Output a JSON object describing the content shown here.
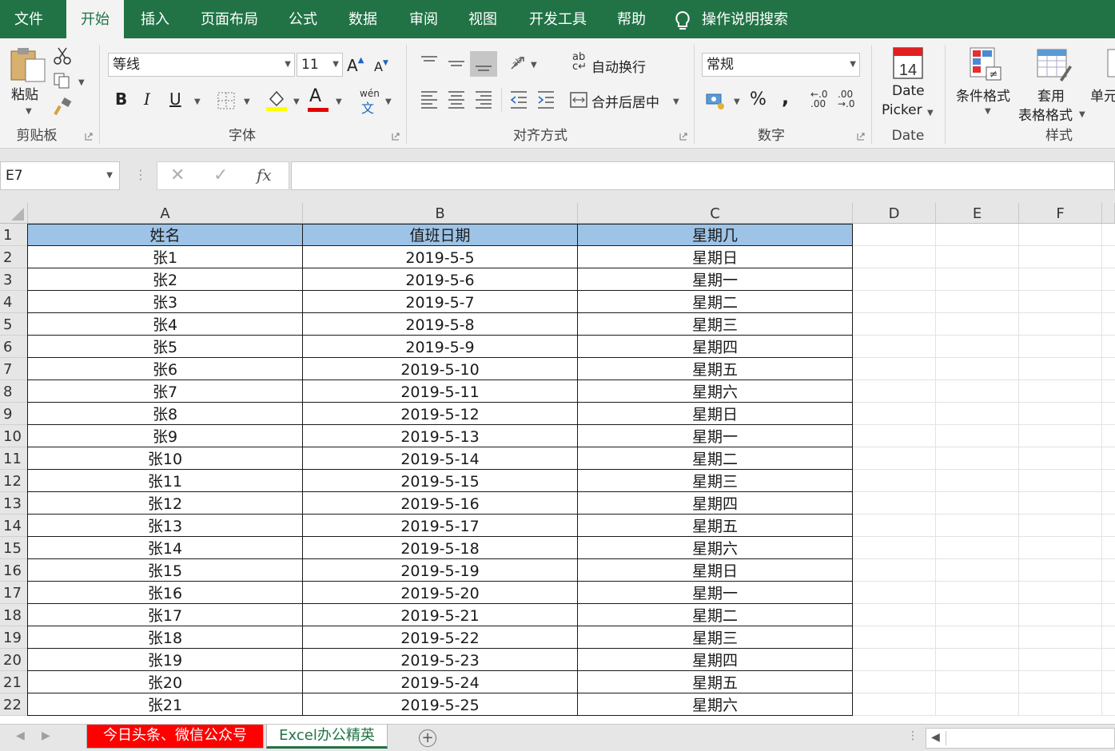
{
  "tabs": [
    {
      "label": "文件",
      "active": false
    },
    {
      "label": "开始",
      "active": true
    },
    {
      "label": "插入",
      "active": false
    },
    {
      "label": "页面布局",
      "active": false
    },
    {
      "label": "公式",
      "active": false
    },
    {
      "label": "数据",
      "active": false
    },
    {
      "label": "审阅",
      "active": false
    },
    {
      "label": "视图",
      "active": false
    },
    {
      "label": "开发工具",
      "active": false
    },
    {
      "label": "帮助",
      "active": false
    }
  ],
  "search": {
    "label": "操作说明搜索",
    "icon": "lightbulb-icon"
  },
  "ribbon": {
    "clipboard": {
      "paste": "粘贴",
      "group": "剪贴板"
    },
    "font": {
      "name": "等线",
      "size": "11",
      "bold": "B",
      "italic": "I",
      "underline": "U",
      "phonetic": "wén",
      "group": "字体"
    },
    "alignment": {
      "wrap": "自动换行",
      "merge": "合并后居中",
      "group": "对齐方式"
    },
    "number": {
      "format": "常规",
      "percent": "%",
      "comma": ",",
      "group": "数字"
    },
    "datepicker": {
      "day": "14",
      "line1": "Date",
      "line2": "Picker",
      "group": "Date"
    },
    "styles": {
      "conditional": "条件格式",
      "table_line1": "套用",
      "table_line2": "表格格式",
      "cell": "单元",
      "group": "样式"
    }
  },
  "formula_bar": {
    "cell_ref": "E7",
    "cancel": "✕",
    "enter": "✓",
    "fx": "fx",
    "value": ""
  },
  "columns": [
    "A",
    "B",
    "C",
    "D",
    "E",
    "F"
  ],
  "rows": [
    "1",
    "2",
    "3",
    "4",
    "5",
    "6",
    "7",
    "8",
    "9",
    "10",
    "11",
    "12",
    "13",
    "14",
    "15",
    "16",
    "17",
    "18",
    "19",
    "20",
    "21",
    "22"
  ],
  "table": {
    "headers": [
      "姓名",
      "值班日期",
      "星期几"
    ],
    "data": [
      [
        "张1",
        "2019-5-5",
        "星期日"
      ],
      [
        "张2",
        "2019-5-6",
        "星期一"
      ],
      [
        "张3",
        "2019-5-7",
        "星期二"
      ],
      [
        "张4",
        "2019-5-8",
        "星期三"
      ],
      [
        "张5",
        "2019-5-9",
        "星期四"
      ],
      [
        "张6",
        "2019-5-10",
        "星期五"
      ],
      [
        "张7",
        "2019-5-11",
        "星期六"
      ],
      [
        "张8",
        "2019-5-12",
        "星期日"
      ],
      [
        "张9",
        "2019-5-13",
        "星期一"
      ],
      [
        "张10",
        "2019-5-14",
        "星期二"
      ],
      [
        "张11",
        "2019-5-15",
        "星期三"
      ],
      [
        "张12",
        "2019-5-16",
        "星期四"
      ],
      [
        "张13",
        "2019-5-17",
        "星期五"
      ],
      [
        "张14",
        "2019-5-18",
        "星期六"
      ],
      [
        "张15",
        "2019-5-19",
        "星期日"
      ],
      [
        "张16",
        "2019-5-20",
        "星期一"
      ],
      [
        "张17",
        "2019-5-21",
        "星期二"
      ],
      [
        "张18",
        "2019-5-22",
        "星期三"
      ],
      [
        "张19",
        "2019-5-23",
        "星期四"
      ],
      [
        "张20",
        "2019-5-24",
        "星期五"
      ],
      [
        "张21",
        "2019-5-25",
        "星期六"
      ]
    ]
  },
  "sheets": [
    {
      "label": "今日头条、微信公众号",
      "active": false,
      "color": "#ff0000"
    },
    {
      "label": "Excel办公精英",
      "active": true,
      "color": "#217346"
    }
  ],
  "colors": {
    "accent": "#217346",
    "header_fill": "#9dc3e6",
    "font_color": "#e00000",
    "highlight": "#ffff00"
  }
}
